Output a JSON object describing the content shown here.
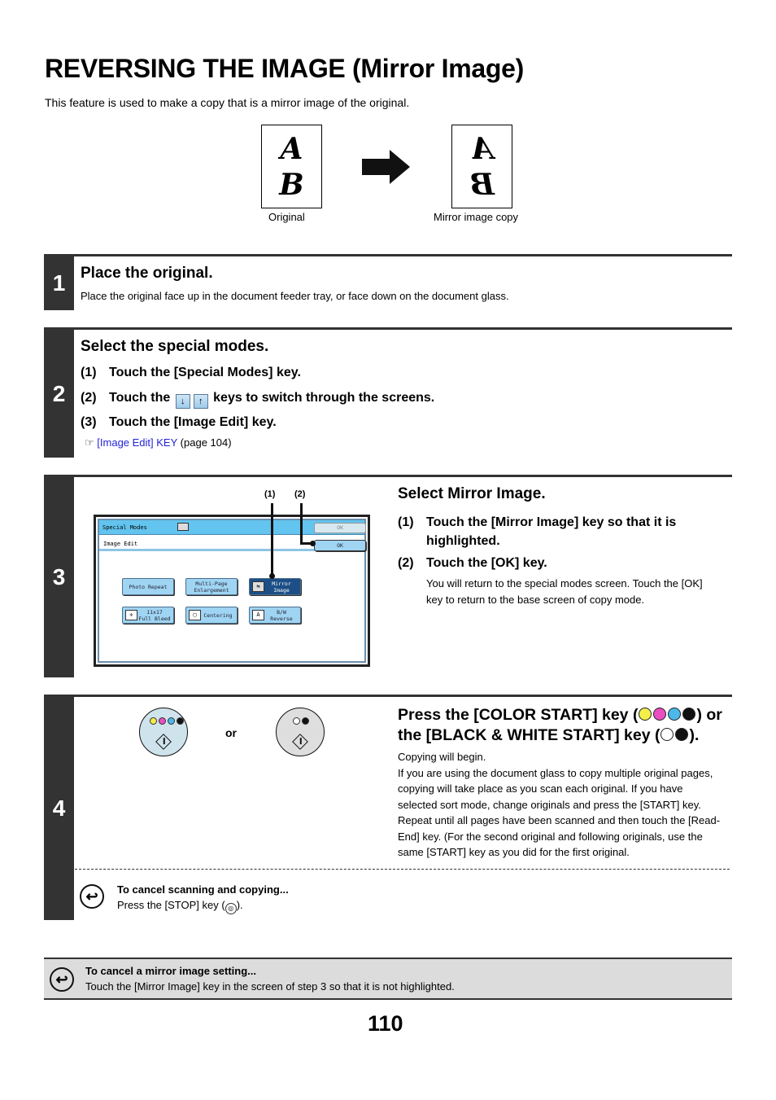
{
  "page": {
    "title": "REVERSING THE IMAGE (Mirror Image)",
    "intro": "This feature is used to make a copy that is a mirror image of the original.",
    "page_number": "110"
  },
  "figure": {
    "original_letters": [
      "A",
      "B"
    ],
    "mirror_letters": [
      "A",
      "B"
    ],
    "original_caption": "Original",
    "mirror_caption": "Mirror image copy"
  },
  "steps": [
    {
      "number": "1",
      "heading": "Place the original.",
      "body": "Place the original face up in the document feeder tray, or face down on the document glass."
    },
    {
      "number": "2",
      "heading": "Select the special modes.",
      "substeps": [
        {
          "n": "(1)",
          "text": "Touch the [Special Modes] key."
        },
        {
          "n": "(2)",
          "text_before": "Touch the",
          "text_after": "keys to switch through the screens."
        },
        {
          "n": "(3)",
          "text": "Touch the [Image Edit] key."
        }
      ],
      "arrow_keys": [
        "↓",
        "↑"
      ],
      "ref_icon": "☞",
      "ref_link": "[Image Edit] KEY",
      "ref_page": "(page 104)"
    },
    {
      "number": "3",
      "heading": "Select Mirror Image.",
      "substeps": [
        {
          "n": "(1)",
          "text": "Touch the [Mirror Image] key so that it is highlighted."
        },
        {
          "n": "(2)",
          "text": "Touch the [OK] key."
        }
      ],
      "body": "You will return to the special modes screen. Touch the [OK] key to return to the base screen of copy mode.",
      "callouts": [
        "(1)",
        "(2)"
      ],
      "screen": {
        "title": "Special Modes",
        "top_ok": "OK",
        "subtitle": "Image Edit",
        "sub_ok": "OK",
        "buttons": [
          {
            "label": "Photo Repeat",
            "selected": false,
            "icon": ""
          },
          {
            "label": "Multi-Page\nEnlargement",
            "selected": false,
            "icon": ""
          },
          {
            "label": "Mirror\nImage",
            "selected": true,
            "icon": "mirror-icon"
          },
          {
            "label": "11x17\nFull Bleed",
            "selected": false,
            "icon": "full-bleed-icon"
          },
          {
            "label": "Centering",
            "selected": false,
            "icon": "centering-icon"
          },
          {
            "label": "B/W\nReverse",
            "selected": false,
            "icon": "bw-reverse-icon"
          }
        ]
      }
    },
    {
      "number": "4",
      "heading_line1_before": "Press the [COLOR START] key (",
      "heading_line1_after": ") or",
      "heading_line2_before": "the [BLACK & WHITE START] key (",
      "heading_line2_after": ").",
      "or_label": "or",
      "color_dots": [
        "#f3ee4a",
        "#ea4ec0",
        "#4cb8ea",
        "#111111"
      ],
      "bw_dots": [
        "#ffffff",
        "#111111"
      ],
      "color_key_bg": "#cfe3ec",
      "bw_key_bg": "#dedede",
      "body_lines": [
        "Copying will begin.",
        "If you are using the document glass to copy multiple original pages, copying will take place as you scan each original. If you have selected sort mode, change originals and press the [START] key. Repeat until all pages have been scanned and then touch the [Read-End] key. (For the second original and following originals, use the same [START] key as you did for the first original."
      ],
      "cancel_title": "To cancel scanning and copying...",
      "cancel_before": "Press the [STOP] key (",
      "cancel_after": ")."
    }
  ],
  "note": {
    "title": "To cancel a mirror image setting...",
    "body": "Touch the [Mirror Image] key in the screen of step 3 so that it is not highlighted."
  }
}
